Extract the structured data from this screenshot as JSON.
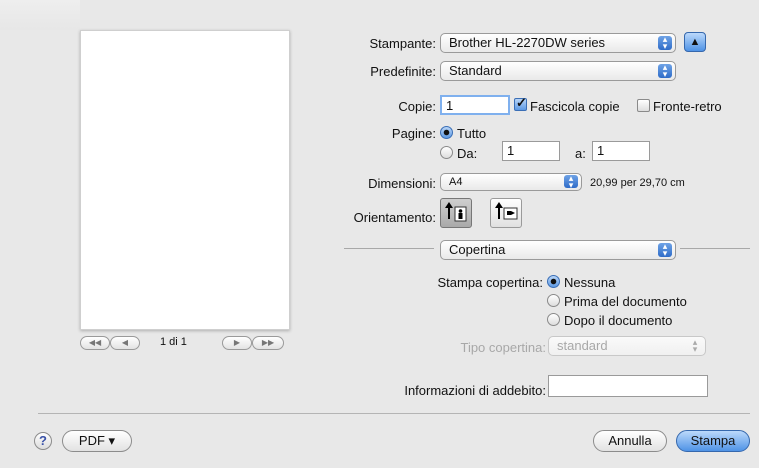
{
  "printer": {
    "label": "Stampante:",
    "value": "Brother HL-2270DW series"
  },
  "presets": {
    "label": "Predefinite:",
    "value": "Standard"
  },
  "copies": {
    "label": "Copie:",
    "value": "1",
    "collate_label": "Fascicola copie",
    "duplex_label": "Fronte-retro"
  },
  "pages": {
    "label": "Pagine:",
    "all_label": "Tutto",
    "from_label": "Da:",
    "from_value": "1",
    "to_label": "a:",
    "to_value": "1"
  },
  "paper": {
    "label": "Dimensioni:",
    "value": "A4",
    "size_text": "20,99 per 29,70 cm"
  },
  "orientation": {
    "label": "Orientamento:"
  },
  "section": {
    "value": "Copertina"
  },
  "cover": {
    "label": "Stampa copertina:",
    "options": [
      "Nessuna",
      "Prima del documento",
      "Dopo il documento"
    ],
    "type_label": "Tipo copertina:",
    "type_value": "standard"
  },
  "billing": {
    "label": "Informazioni di addebito:",
    "value": ""
  },
  "preview": {
    "page_counter": "1 di 1"
  },
  "footer": {
    "help": "?",
    "pdf_label": "PDF ▾",
    "cancel_label": "Annulla",
    "print_label": "Stampa"
  },
  "colors": {
    "accent": "#4f93e6",
    "background": "#e8e8e8"
  }
}
